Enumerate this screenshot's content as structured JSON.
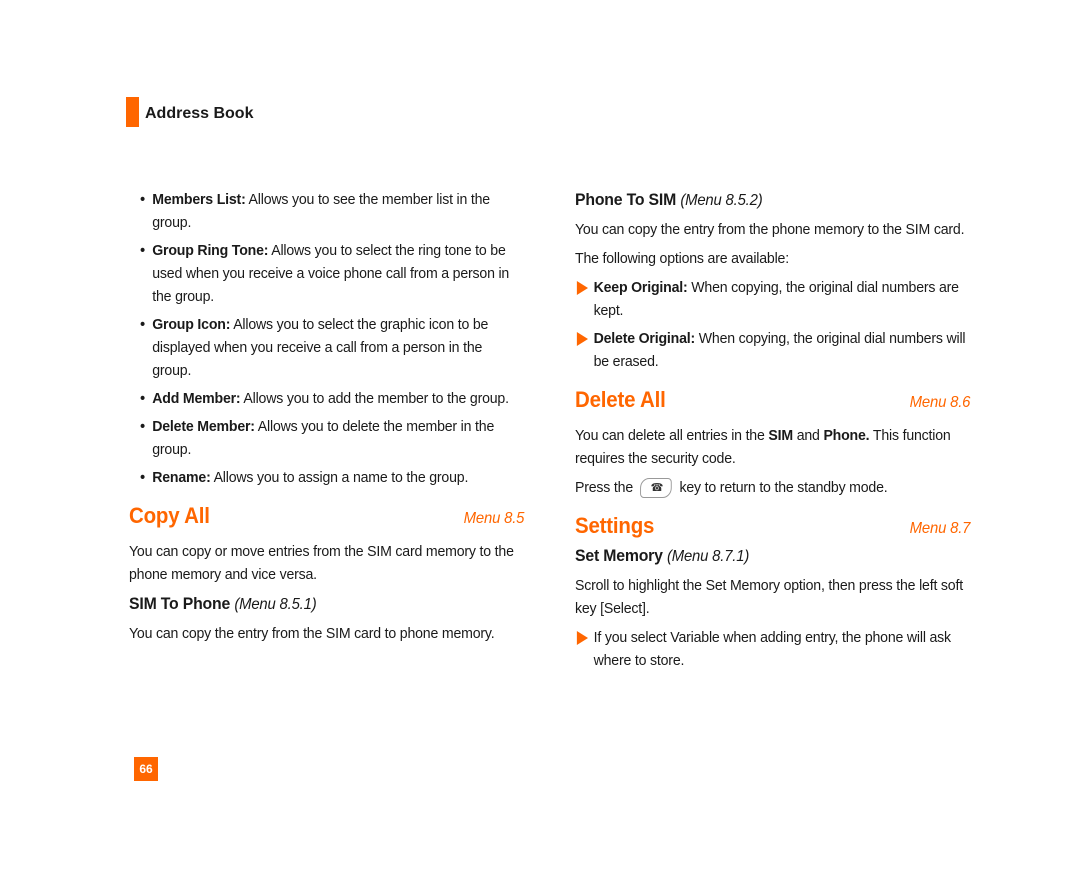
{
  "header": {
    "section_title": "Address Book"
  },
  "left": {
    "group_options": [
      {
        "term": "Members List:",
        "desc": " Allows you to see the member list in the group."
      },
      {
        "term": "Group Ring Tone:",
        "desc": " Allows you to select the ring tone to be used when you receive a voice phone call from a person in the group."
      },
      {
        "term": "Group Icon:",
        "desc": " Allows you to select the graphic icon to be displayed when you receive a call from a person in the group."
      },
      {
        "term": "Add Member:",
        "desc": " Allows you to add the member to the group."
      },
      {
        "term": "Delete Member:",
        "desc": " Allows you to delete the member in the group."
      },
      {
        "term": "Rename:",
        "desc": " Allows you to assign a name to the group."
      }
    ],
    "copy_all": {
      "title": "Copy All",
      "menu": "Menu 8.5",
      "body": "You can copy or move entries from the SIM card memory to the phone memory and vice versa.",
      "sim_to_phone": {
        "title": "SIM To Phone",
        "menu": "(Menu 8.5.1)",
        "body": "You can copy the entry from the SIM card to phone memory."
      }
    }
  },
  "right": {
    "phone_to_sim": {
      "title": "Phone To SIM",
      "menu": "(Menu 8.5.2)",
      "body": "You can copy the entry from the phone memory to the SIM card.",
      "options_intro": "The following options are available:",
      "options": [
        {
          "term": "Keep Original:",
          "desc": " When copying, the original dial numbers are kept."
        },
        {
          "term": "Delete Original:",
          "desc": " When copying, the original dial numbers will be erased."
        }
      ]
    },
    "delete_all": {
      "title": "Delete All",
      "menu": "Menu 8.6",
      "body_pre": "You can delete all entries in the ",
      "body_sim": "SIM",
      "body_mid": " and ",
      "body_phone": "Phone.",
      "body_post": " This function requires the security code.",
      "press_pre": "Press the",
      "press_post": "key to return to the standby mode.",
      "key_icon": "end-call-key-icon"
    },
    "settings": {
      "title": "Settings",
      "menu": "Menu 8.7",
      "set_memory": {
        "title": "Set Memory",
        "menu": "(Menu 8.7.1)",
        "body": "Scroll to highlight the Set Memory option, then press the left soft key [Select].",
        "note": "If you select Variable when adding entry, the phone will ask where to store."
      }
    }
  },
  "footer": {
    "page_number": "66"
  },
  "colors": {
    "accent": "#ff6600",
    "text": "#1a1a1a"
  }
}
